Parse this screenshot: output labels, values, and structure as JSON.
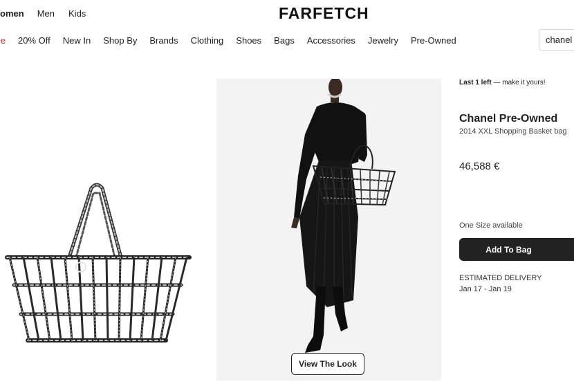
{
  "gender_nav": [
    "Women",
    "Men",
    "Kids"
  ],
  "logo": "FARFETCH",
  "category_nav": [
    "Sale",
    "20% Off",
    "New In",
    "Shop By",
    "Brands",
    "Clothing",
    "Shoes",
    "Bags",
    "Accessories",
    "Jewelry",
    "Pre-Owned"
  ],
  "search": {
    "value": "chanel"
  },
  "gallery": {
    "look_button": "View The Look"
  },
  "product": {
    "stock_bold": "Last 1 left",
    "stock_rest": " — make it yours!",
    "brand": "Chanel Pre-Owned",
    "name": "2014 XXL Shopping Basket bag",
    "price": "46,588 €",
    "size": "One Size available",
    "add_to_bag": "Add To Bag",
    "delivery_label": "ESTIMATED DELIVERY",
    "delivery_dates": "Jan 17 - Jan 19"
  },
  "colors": {
    "sale": "#d12a2a",
    "button_dark": "#222222",
    "image_bg": "#f3f3f3"
  }
}
